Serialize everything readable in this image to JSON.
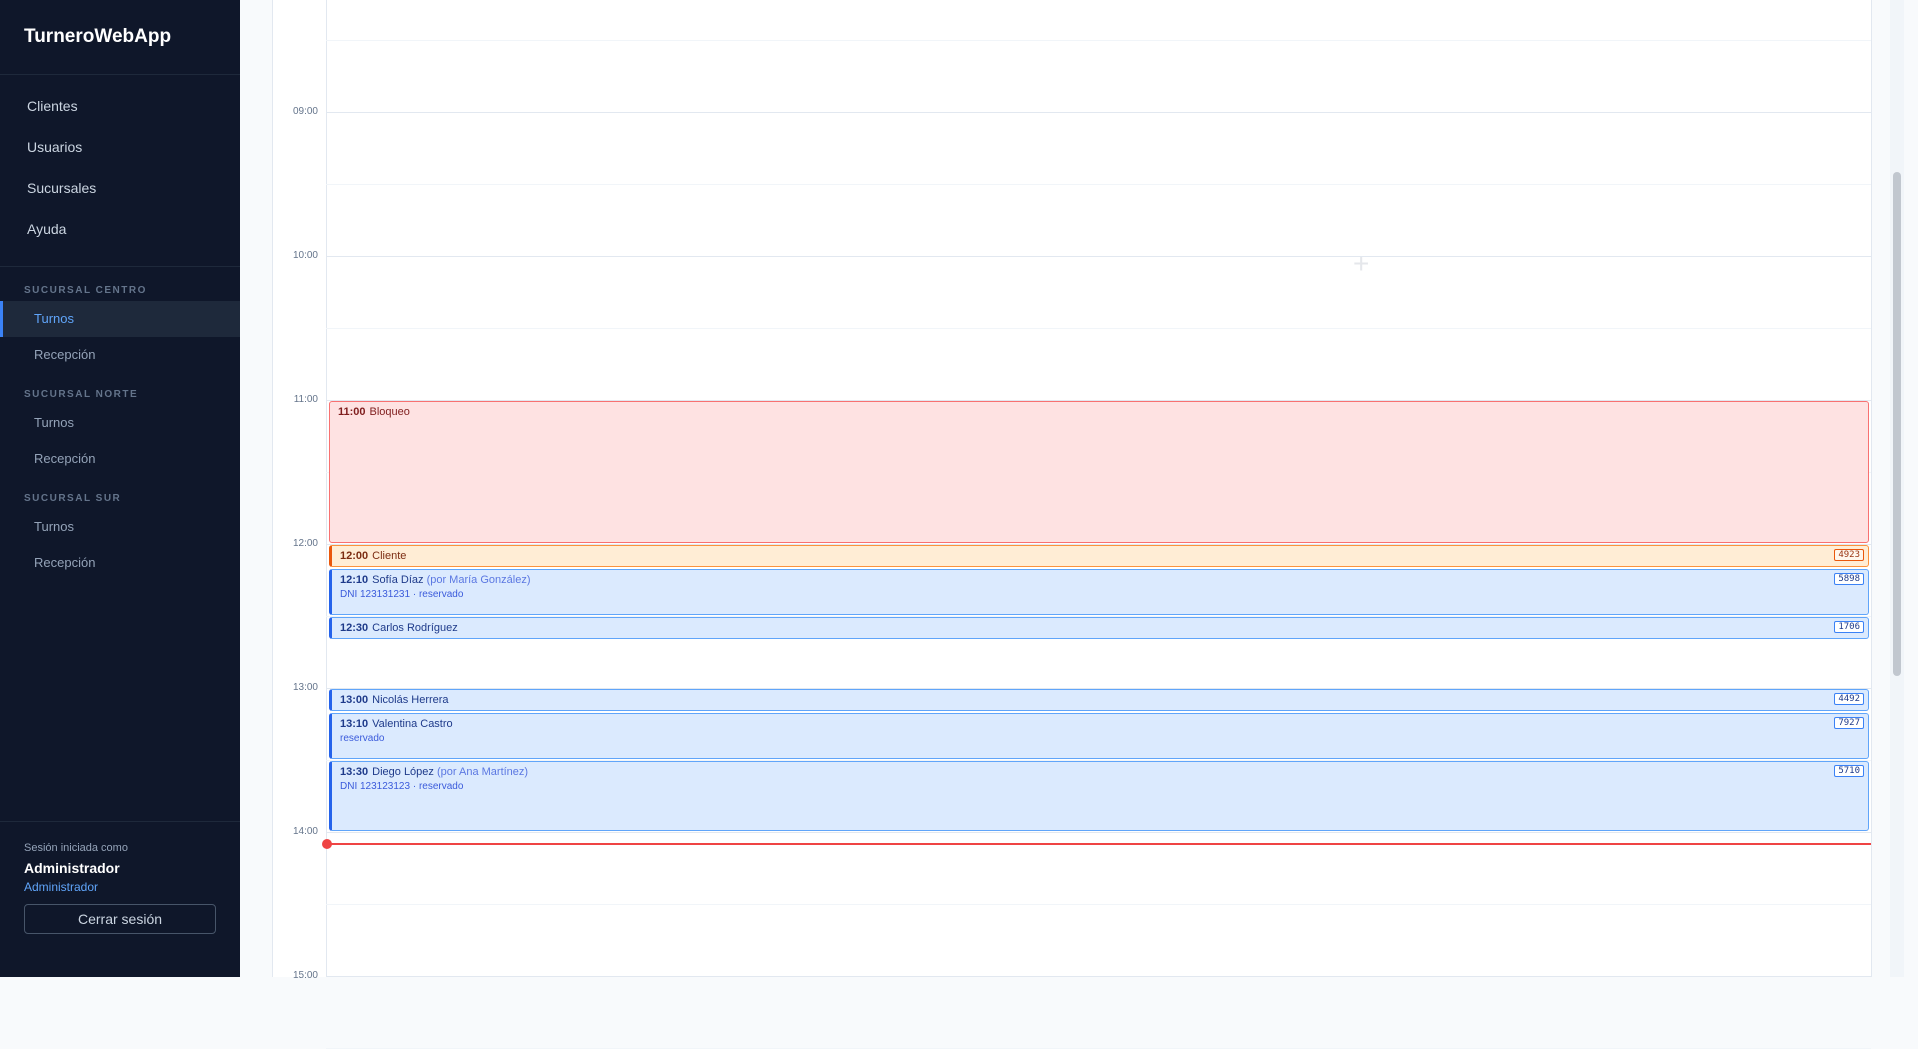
{
  "app": {
    "title": "TurneroWebApp"
  },
  "nav": [
    {
      "label": "Clientes"
    },
    {
      "label": "Usuarios"
    },
    {
      "label": "Sucursales"
    },
    {
      "label": "Ayuda"
    }
  ],
  "branches": [
    {
      "label": "SUCURSAL CENTRO",
      "items": [
        {
          "label": "Turnos",
          "active": true
        },
        {
          "label": "Recepción"
        }
      ]
    },
    {
      "label": "SUCURSAL NORTE",
      "items": [
        {
          "label": "Turnos"
        },
        {
          "label": "Recepción"
        }
      ]
    },
    {
      "label": "SUCURSAL SUR",
      "items": [
        {
          "label": "Turnos"
        },
        {
          "label": "Recepción"
        }
      ]
    }
  ],
  "session": {
    "caption": "Sesión iniciada como",
    "name": "Administrador",
    "role": "Administrador",
    "logout_label": "Cerrar sesión"
  },
  "calendar": {
    "hours": [
      "09:00",
      "10:00",
      "11:00",
      "12:00",
      "13:00",
      "14:00",
      "15:00"
    ],
    "now": "14:05",
    "events": [
      {
        "kind": "block",
        "time": "11:00",
        "name": "Bloqueo",
        "start": "11:00",
        "end": "12:00"
      },
      {
        "kind": "client",
        "time": "12:00",
        "name": "Cliente",
        "badge": "4923",
        "start": "12:00",
        "end": "12:10"
      },
      {
        "kind": "appt",
        "time": "12:10",
        "name": "Sofía Díaz",
        "by": "(por María González)",
        "sub": "DNI 123131231 · reservado",
        "badge": "5898",
        "start": "12:10",
        "end": "12:30"
      },
      {
        "kind": "appt",
        "time": "12:30",
        "name": "Carlos Rodríguez",
        "badge": "1706",
        "start": "12:30",
        "end": "12:40"
      },
      {
        "kind": "appt",
        "time": "13:00",
        "name": "Nicolás Herrera",
        "badge": "4492",
        "start": "13:00",
        "end": "13:10"
      },
      {
        "kind": "appt",
        "time": "13:10",
        "name": "Valentina Castro",
        "sub": "reservado",
        "badge": "7927",
        "start": "13:10",
        "end": "13:30"
      },
      {
        "kind": "appt",
        "time": "13:30",
        "name": "Diego López",
        "by": "(por Ana Martínez)",
        "sub": "DNI 123123123 · reservado",
        "badge": "5710",
        "start": "13:30",
        "end": "14:00"
      }
    ]
  }
}
